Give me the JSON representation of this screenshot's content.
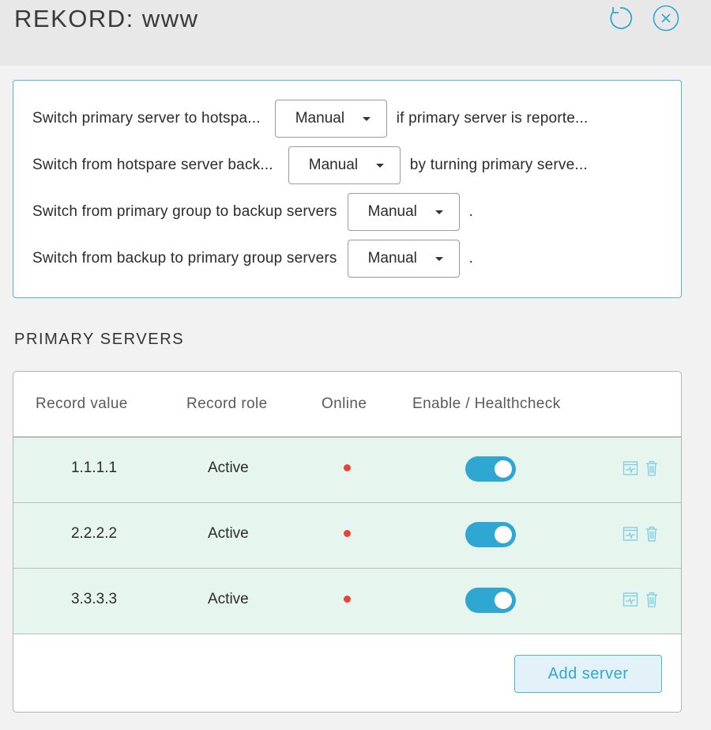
{
  "header": {
    "title": "REKORD: www",
    "refresh_icon": "refresh-icon",
    "close_icon": "close-icon"
  },
  "rules": [
    {
      "prefix": "Switch primary server to hotspa...",
      "value": "Manual",
      "suffix": "if primary server is reporte..."
    },
    {
      "prefix": "Switch from hotspare server back...",
      "value": "Manual",
      "suffix": "by turning primary serve..."
    },
    {
      "prefix": "Switch from primary group to backup servers",
      "value": "Manual",
      "suffix": "."
    },
    {
      "prefix": "Switch from backup to primary group servers",
      "value": "Manual",
      "suffix": "."
    }
  ],
  "primary_servers": {
    "title": "PRIMARY SERVERS",
    "columns": [
      "Record value",
      "Record role",
      "Online",
      "Enable / Healthcheck"
    ],
    "rows": [
      {
        "value": "1.1.1.1",
        "role": "Active",
        "online": false,
        "enabled": true
      },
      {
        "value": "2.2.2.2",
        "role": "Active",
        "online": false,
        "enabled": true
      },
      {
        "value": "3.3.3.3",
        "role": "Active",
        "online": false,
        "enabled": true
      }
    ],
    "add_button": "Add server"
  },
  "colors": {
    "accent": "#2fa7d3",
    "row_bg": "#e6f6ee",
    "offline_dot": "#ea4335"
  }
}
